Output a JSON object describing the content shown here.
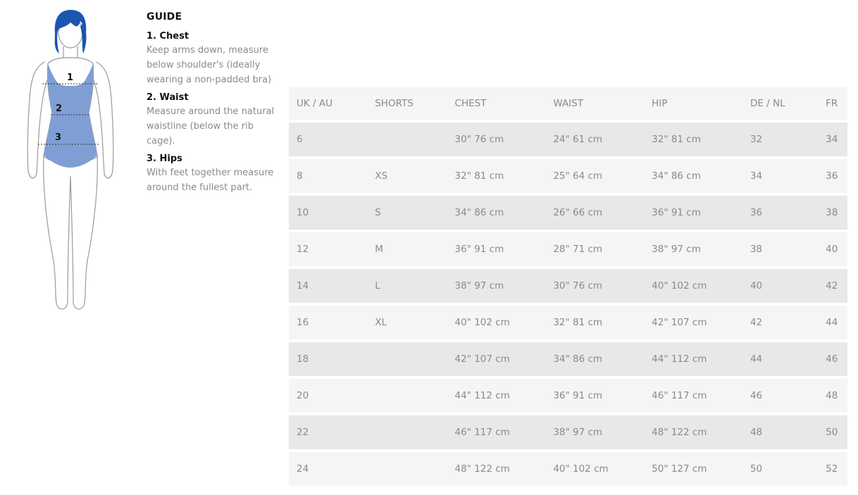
{
  "guide": {
    "title": "GUIDE",
    "items": [
      {
        "title": "1. Chest",
        "text": "Keep arms down, measure below shoulder's (ideally wearing a non-padded bra)"
      },
      {
        "title": "2. Waist",
        "text": "Measure around the natural waistline (below the rib cage)."
      },
      {
        "title": "3. Hips",
        "text": "With feet together measure around the fullest part."
      }
    ]
  },
  "figure": {
    "labels": [
      "1",
      "2",
      "3"
    ],
    "colors": {
      "hair": "#1a56b0",
      "swimsuit": "#7f9fd4",
      "outline": "#9a9a9a"
    }
  },
  "table": {
    "headers": [
      "UK / AU",
      "SHORTS",
      "CHEST",
      "WAIST",
      "HIP",
      "DE / NL",
      "FR"
    ],
    "rows": [
      [
        "6",
        "",
        "30\" 76 cm",
        "24\" 61 cm",
        "32\" 81 cm",
        "32",
        "34"
      ],
      [
        "8",
        "XS",
        "32\" 81 cm",
        "25\" 64 cm",
        "34\" 86 cm",
        "34",
        "36"
      ],
      [
        "10",
        "S",
        "34\" 86 cm",
        "26\" 66 cm",
        "36\" 91 cm",
        "36",
        "38"
      ],
      [
        "12",
        "M",
        "36\" 91 cm",
        "28\" 71 cm",
        "38\" 97 cm",
        "38",
        "40"
      ],
      [
        "14",
        "L",
        "38\" 97 cm",
        "30\" 76 cm",
        "40\" 102 cm",
        "40",
        "42"
      ],
      [
        "16",
        "XL",
        "40\" 102 cm",
        "32\" 81 cm",
        "42\" 107 cm",
        "42",
        "44"
      ],
      [
        "18",
        "",
        "42\" 107 cm",
        "34\" 86 cm",
        "44\" 112 cm",
        "44",
        "46"
      ],
      [
        "20",
        "",
        "44\" 112 cm",
        "36\" 91 cm",
        "46\" 117 cm",
        "46",
        "48"
      ],
      [
        "22",
        "",
        "46\" 117 cm",
        "38\" 97 cm",
        "48\" 122 cm",
        "48",
        "50"
      ],
      [
        "24",
        "",
        "48\" 122 cm",
        "40\" 102 cm",
        "50\" 127 cm",
        "50",
        "52"
      ]
    ]
  }
}
